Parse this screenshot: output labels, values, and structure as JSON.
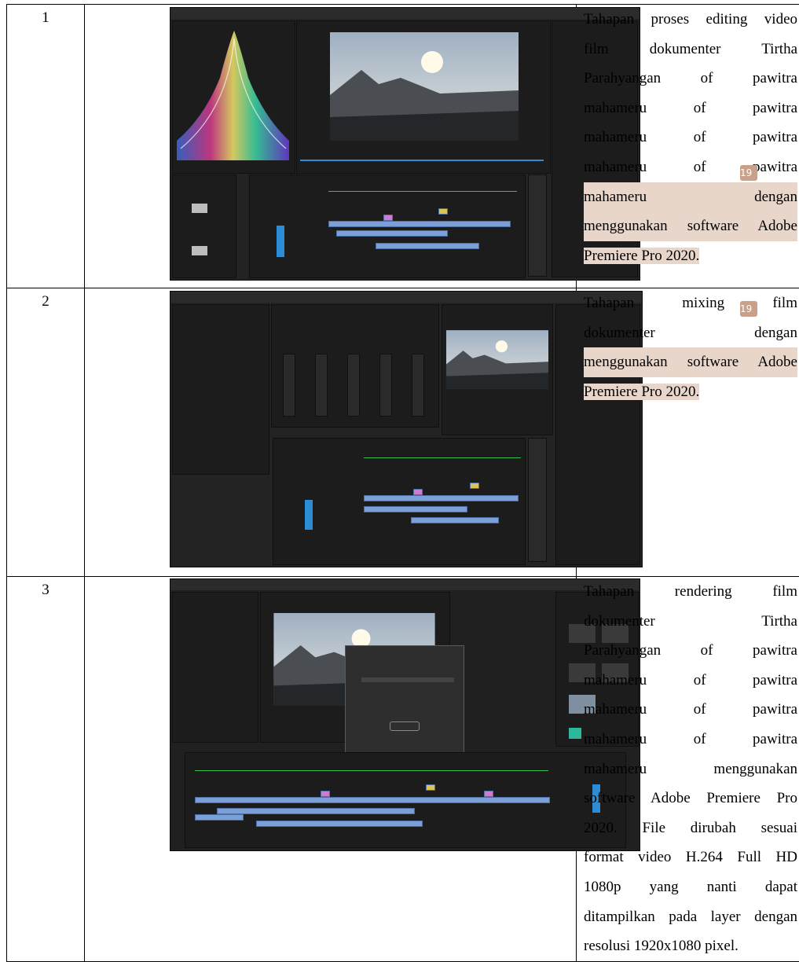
{
  "rows": [
    {
      "number": "1",
      "screenshot_icon": "premiere-editing-screenshot",
      "badge": "19",
      "lines": [
        "Tahapan proses editing video",
        "film dokumenter Tirtha",
        "Parahyangan of pawitra",
        "mahameru of pawitra",
        "mahameru of pawitra",
        "mahameru of pawitra",
        "mahameru dengan",
        "menggunakan software Adobe",
        "Premiere Pro 2020."
      ]
    },
    {
      "number": "2",
      "screenshot_icon": "premiere-mixing-screenshot",
      "badge": "19",
      "lines": [
        "Tahapan mixing film",
        "dokumenter dengan",
        "menggunakan software Adobe",
        "Premiere Pro 2020."
      ]
    },
    {
      "number": "3",
      "screenshot_icon": "premiere-rendering-screenshot",
      "lines": [
        "Tahapan rendering film",
        "dokumenter Tirtha",
        "Parahyangan of pawitra",
        "mahameru of pawitra",
        "mahameru of pawitra",
        "mahameru of pawitra",
        "mahameru menggunakan",
        "software Adobe Premiere Pro",
        "2020. File dirubah sesuai",
        "format video H.264 Full HD",
        "1080p yang nanti dapat",
        "ditampilkan pada layer dengan",
        "resolusi 1920x1080 pixel."
      ]
    }
  ],
  "colors": {
    "highlight": "#e8d6cb",
    "badge": "#c9a18a",
    "ui_dark": "#232323",
    "clip_blue": "#7b9fd6"
  }
}
